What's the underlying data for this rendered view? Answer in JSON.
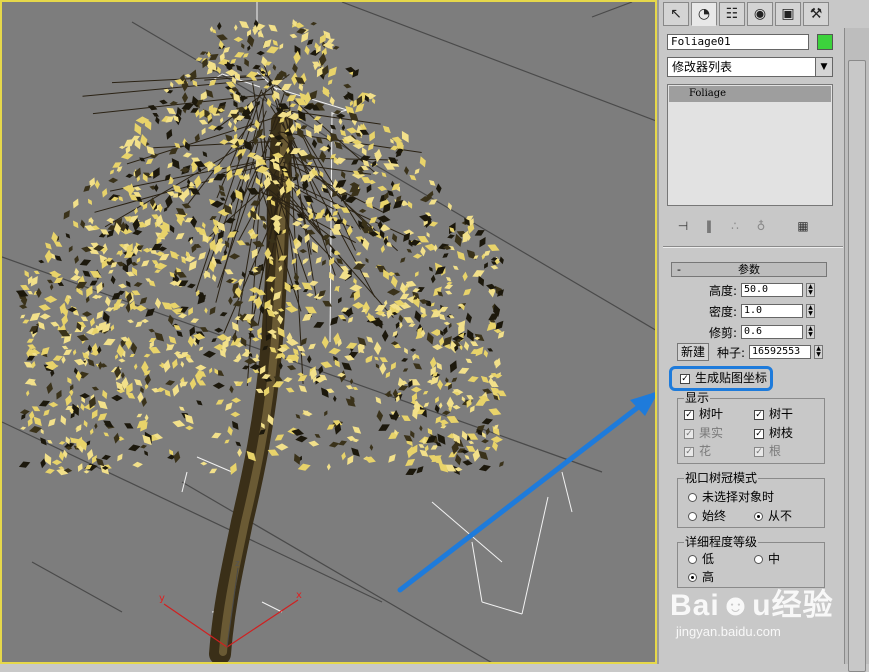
{
  "panel": {
    "tabs": [
      {
        "name": "create",
        "glyph": "↖"
      },
      {
        "name": "modify",
        "glyph": "◔"
      },
      {
        "name": "hierarchy",
        "glyph": "☷"
      },
      {
        "name": "motion",
        "glyph": "◉"
      },
      {
        "name": "display",
        "glyph": "▣"
      },
      {
        "name": "utilities",
        "glyph": "⚒"
      }
    ],
    "object_name": "Foliage01",
    "object_color": "#3cd23c",
    "modifier_list": "修改器列表",
    "stack_item": "Foliage",
    "stack_tools": [
      {
        "name": "pin-stack-icon",
        "glyph": "⊣"
      },
      {
        "name": "show-end-result-icon",
        "glyph": "‖"
      },
      {
        "name": "make-unique-icon",
        "glyph": "∴"
      },
      {
        "name": "remove-modifier-icon",
        "glyph": "♁"
      },
      {
        "name": "configure-sets-icon",
        "glyph": "▦"
      }
    ]
  },
  "params": {
    "rollout_title": "参数",
    "collapse": "-",
    "height_label": "高度:",
    "height_value": "50.0",
    "density_label": "密度:",
    "density_value": "1.0",
    "prune_label": "修剪:",
    "prune_value": "0.6",
    "new_button": "新建",
    "seed_label": "种子:",
    "seed_value": "16592553",
    "gen_map_coords": "生成贴图坐标",
    "display_title": "显示",
    "leaves": "树叶",
    "trunk": "树干",
    "fruit": "果实",
    "branches": "树枝",
    "flowers": "花",
    "roots": "根",
    "canopy_title": "视口树冠模式",
    "when_not_selected": "未选择对象时",
    "always": "始终",
    "never": "从不",
    "detail_title": "详细程度等级",
    "low": "低",
    "medium": "中",
    "high": "高"
  },
  "viewport": {
    "axis_x": "x",
    "axis_y": "y",
    "axis_z": "z"
  },
  "watermark": {
    "brand": "Bai☻u经验",
    "url": "jingyan.baidu.com"
  }
}
